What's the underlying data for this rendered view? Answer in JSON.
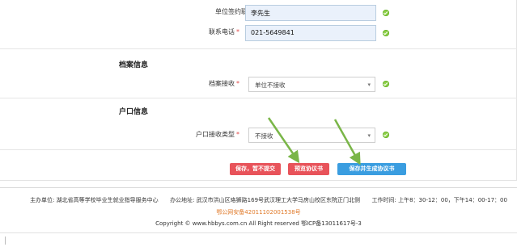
{
  "form": {
    "contact_person": {
      "label": "单位签约联系人",
      "required_mark": "*",
      "value": "李先生"
    },
    "contact_phone": {
      "label": "联系电话",
      "required_mark": "*",
      "value": "021-5649841"
    }
  },
  "archive_section": {
    "title": "档案信息",
    "archive_receive": {
      "label": "档案接收",
      "required_mark": "*",
      "selected": "单位不接收"
    }
  },
  "hukou_section": {
    "title": "户口信息",
    "hukou_receive_type": {
      "label": "户口接收类型",
      "required_mark": "*",
      "selected": "不接收"
    }
  },
  "actions": {
    "save_label": "保存，暂不提交",
    "preview_label": "预览协议书",
    "save_generate_label": "保存并生成协议书"
  },
  "footer": {
    "host_label": "主办单位:",
    "host_value": "湖北省高等学校毕业生就业指导服务中心",
    "address_label": "办公地址:",
    "address_value": "武汉市洪山区珞狮路169号武汉理工大学马房山校区东院正门北侧",
    "hours_label": "工作时间:",
    "hours_value": "上午8：30-12：00，下午14：00-17：00",
    "police_record": "鄂公网安备42011102001538号",
    "copyright": "Copyright © www.hbbys.com.cn All Right reserved 鄂ICP备13011617号-3"
  },
  "colors": {
    "accent_blue": "#3a9de0",
    "accent_red": "#e8535a",
    "arrow_green": "#7ab648",
    "valid_green": "#8fd14a",
    "record_orange": "#e07a2a"
  },
  "icons": {
    "valid": "check-circle-icon",
    "dropdown": "chevron-down-icon",
    "annotation": "arrow-icon"
  }
}
